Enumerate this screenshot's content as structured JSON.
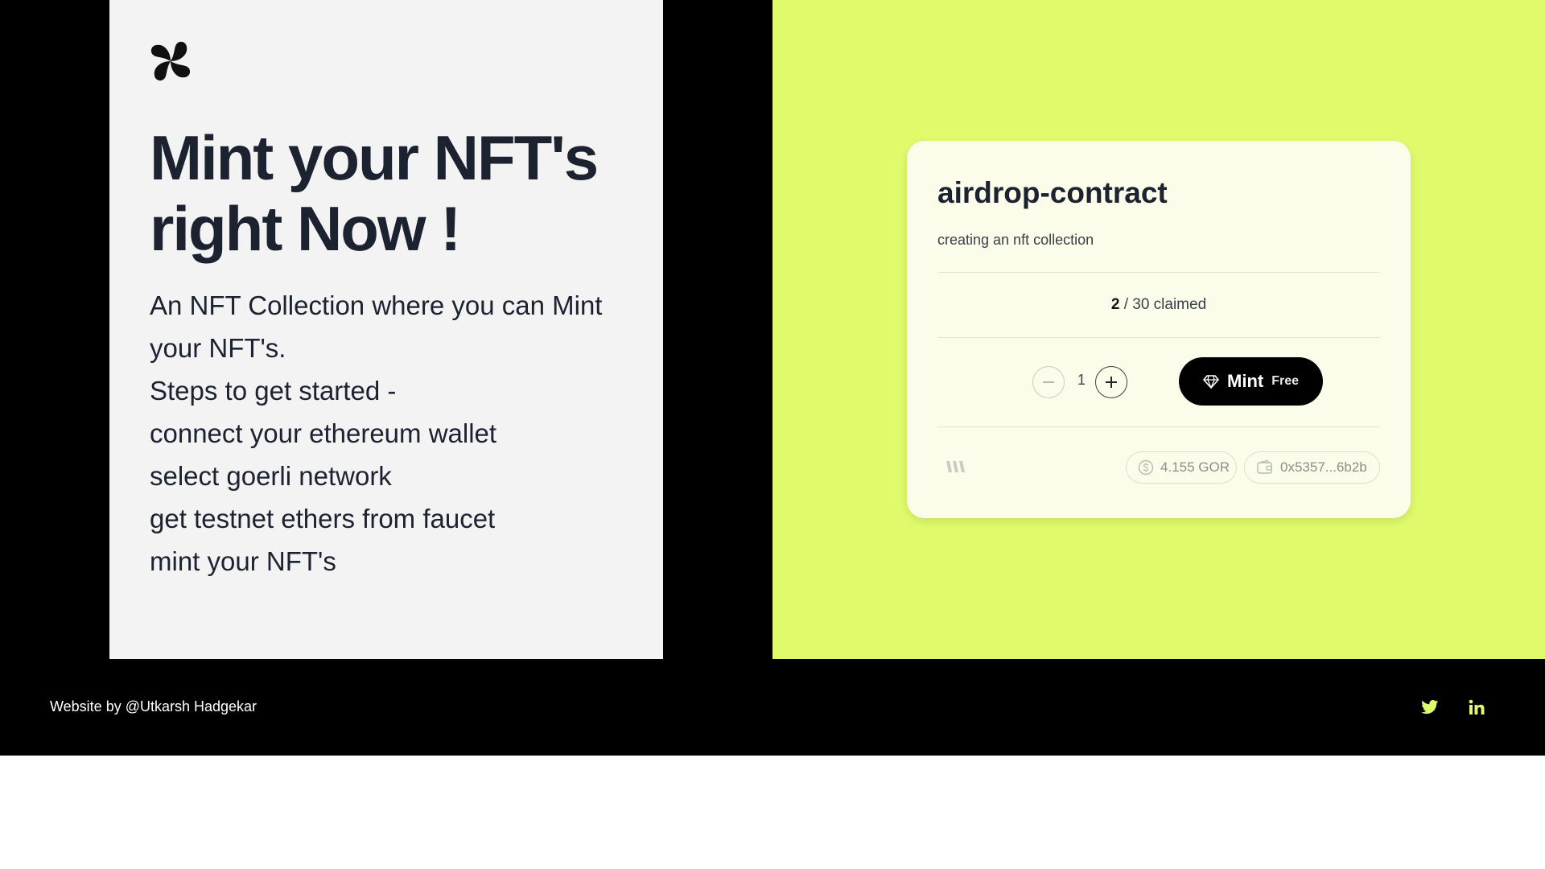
{
  "left": {
    "logo_icon": "four-petal-swirl-logo-icon",
    "hero_lines": [
      "Mint your NFT's",
      "right Now !"
    ],
    "desc_lines": [
      "An NFT Collection where you can Mint",
      "your NFT's.",
      "Steps to get started -",
      "connect your ethereum wallet",
      "select goerli network",
      "get testnet ethers from faucet",
      "mint your NFT's"
    ]
  },
  "card": {
    "title": "airdrop-contract",
    "subtitle": "creating an nft collection",
    "claimed_count": "2",
    "claimed_rest": "/ 30 claimed",
    "quantity": "1",
    "minus_icon": "minus-icon",
    "plus_icon": "plus-icon",
    "mint_icon": "diamond-icon",
    "mint_label": "Mint",
    "mint_price": "Free",
    "brand_icon": "thirdweb-logo-icon",
    "balance_icon": "dollar-circle-icon",
    "balance": "4.155 GOR",
    "wallet_icon": "wallet-icon",
    "wallet": "0x5357...6b2b"
  },
  "footer": {
    "credit": "Website by @Utkarsh Hadgekar",
    "social": [
      "twitter-icon",
      "linkedin-icon"
    ]
  },
  "colors": {
    "accent_lime": "#dffa6b",
    "card_bg": "#fbfdea",
    "left_bg": "#f3f3f3",
    "text_dark": "#1c2230",
    "black": "#000000"
  }
}
